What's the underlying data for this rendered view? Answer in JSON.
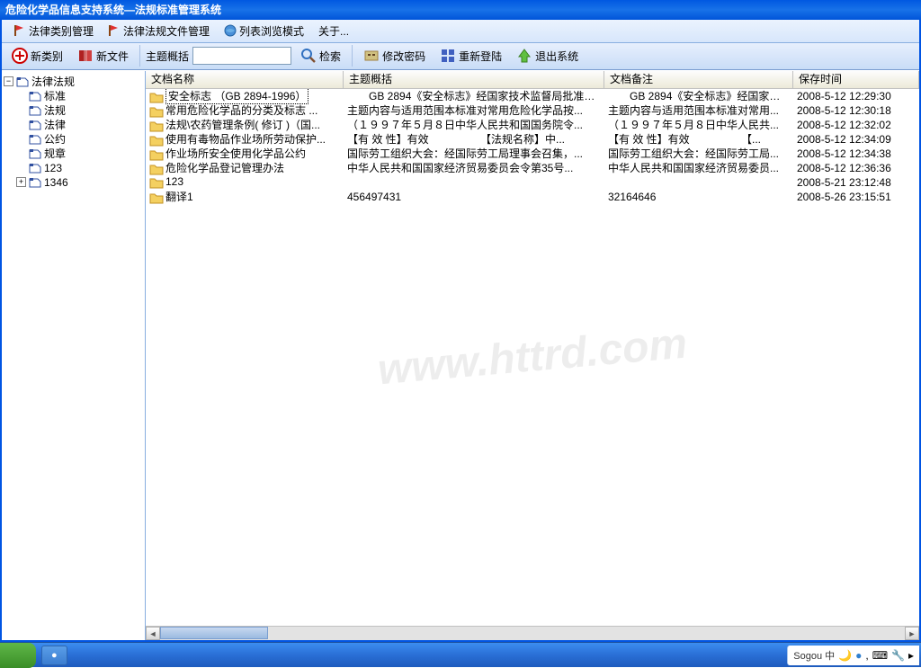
{
  "title": "危险化学品信息支持系统—法规标准管理系统",
  "menubar": {
    "items": [
      {
        "label": "法律类别管理",
        "icon": "flag"
      },
      {
        "label": "法律法规文件管理",
        "icon": "flag"
      },
      {
        "label": "列表浏览模式",
        "icon": "globe"
      },
      {
        "label": "关于...",
        "icon": null
      }
    ]
  },
  "toolbar": {
    "new_category": "新类别",
    "new_file": "新文件",
    "summary_label": "主题概括",
    "search": "检索",
    "change_password": "修改密码",
    "relogin": "重新登陆",
    "exit": "退出系统"
  },
  "tree": {
    "root": {
      "label": "法律法规",
      "expanded": true
    },
    "children": [
      {
        "label": "标准"
      },
      {
        "label": "法规"
      },
      {
        "label": "法律"
      },
      {
        "label": "公约"
      },
      {
        "label": "规章"
      },
      {
        "label": "123"
      },
      {
        "label": "1346",
        "expandable": true
      }
    ]
  },
  "list": {
    "columns": [
      "文档名称",
      "主题概括",
      "文档备注",
      "保存时间"
    ],
    "rows": [
      {
        "name": "安全标志 （GB 2894-1996）",
        "summary": "　　GB 2894《安全标志》经国家技术监督局批准实...",
        "remark": "　　GB 2894《安全标志》经国家技术...",
        "time": "2008-5-12 12:29:30",
        "selected": true
      },
      {
        "name": "常用危险化学品的分类及标志 ...",
        "summary": "主题内容与适用范围本标准对常用危险化学品按...",
        "remark": "主题内容与适用范围本标准对常用...",
        "time": "2008-5-12 12:30:18"
      },
      {
        "name": "法规\\农药管理条例( 修订 )（国...",
        "summary": "（１９９７年５月８日中华人民共和国国务院令...",
        "remark": "（１９９７年５月８日中华人民共...",
        "time": "2008-5-12 12:32:02"
      },
      {
        "name": "使用有毒物品作业场所劳动保护...",
        "summary": "【有 效 性】有效 　　　　　【法规名称】中...",
        "remark": "【有 效 性】有效 　　　　　【...",
        "time": "2008-5-12 12:34:09"
      },
      {
        "name": "作业场所安全使用化学品公约",
        "summary": "国际劳工组织大会：经国际劳工局理事会召集，...",
        "remark": "国际劳工组织大会：经国际劳工局...",
        "time": "2008-5-12 12:34:38"
      },
      {
        "name": "危险化学品登记管理办法",
        "summary": "中华人民共和国国家经济贸易委员会令第35号...",
        "remark": "中华人民共和国国家经济贸易委员...",
        "time": "2008-5-12 12:36:36"
      },
      {
        "name": "123",
        "summary": "",
        "remark": "",
        "time": "2008-5-21 23:12:48"
      },
      {
        "name": "翻译1",
        "summary": "456497431",
        "remark": "32164646",
        "time": "2008-5-26 23:15:51"
      }
    ]
  },
  "watermark": "www.httrd.com",
  "tray": {
    "ime": "Sogou 中"
  }
}
